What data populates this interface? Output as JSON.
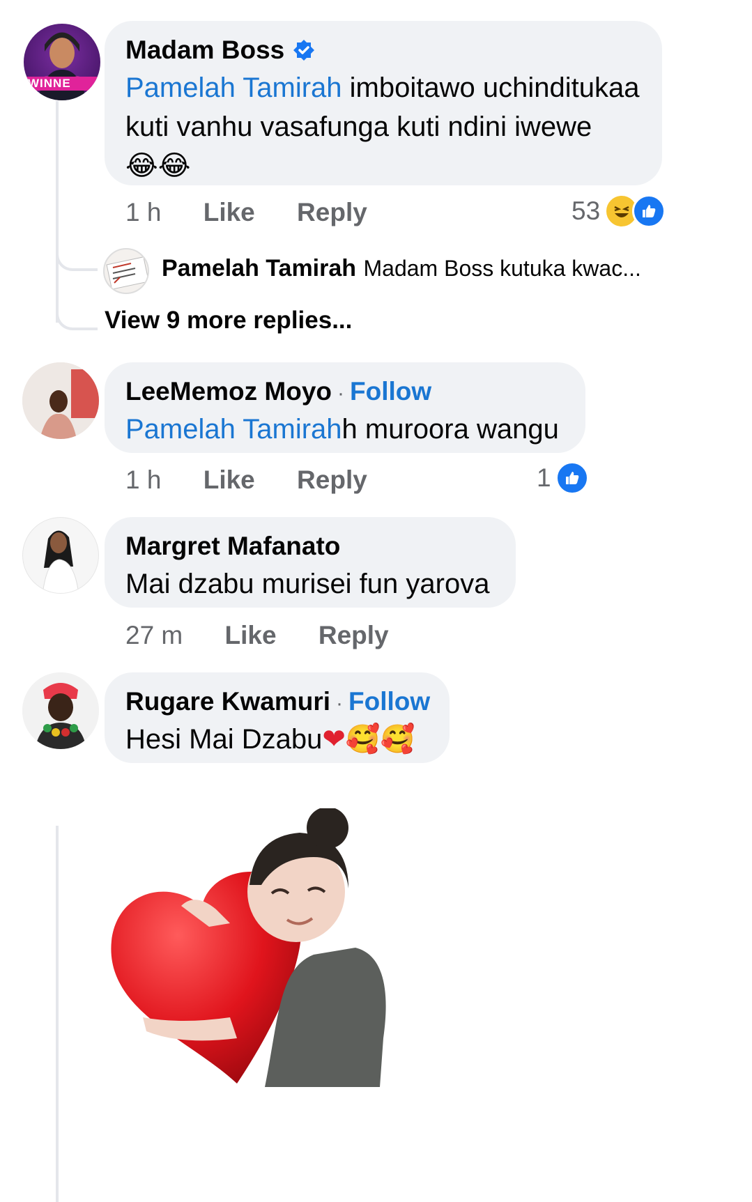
{
  "comments": [
    {
      "name": "Madam Boss",
      "mention": "Pamelah Tamirah",
      "text_line1": " imboitawo uchinditukaa",
      "text_line2": "kuti vanhu vasafunga kuti ndini iwewe",
      "emojis": "😂😂",
      "time": "1 h",
      "like": "Like",
      "reply": "Reply",
      "reaction_count": "53",
      "avatar_banner": "WINNE"
    },
    {
      "name": "LeeMemoz Moyo",
      "follow": "Follow",
      "mention": "Pamelah Tamirah",
      "text": "h muroora wangu",
      "time": "1 h",
      "like": "Like",
      "reply": "Reply",
      "reaction_count": "1"
    },
    {
      "name": "Margret Mafanato",
      "text": "Mai dzabu murisei fun yarova",
      "time": "27 m",
      "like": "Like",
      "reply": "Reply"
    },
    {
      "name": "Rugare Kwamuri",
      "follow": "Follow",
      "text": "Hesi Mai Dzabu",
      "emojis": "❤🥰🥰"
    }
  ],
  "reply_preview": {
    "name": "Pamelah Tamirah",
    "text": "Madam Boss kutuka kwac...",
    "avatar_text": "Single Complicated Married"
  },
  "view_more": "View 9 more replies...",
  "colors": {
    "link": "#1a76d2",
    "bubble": "#f0f2f5",
    "muted": "#65676b",
    "like_blue": "#1877f2",
    "verified": "#1877f2"
  }
}
